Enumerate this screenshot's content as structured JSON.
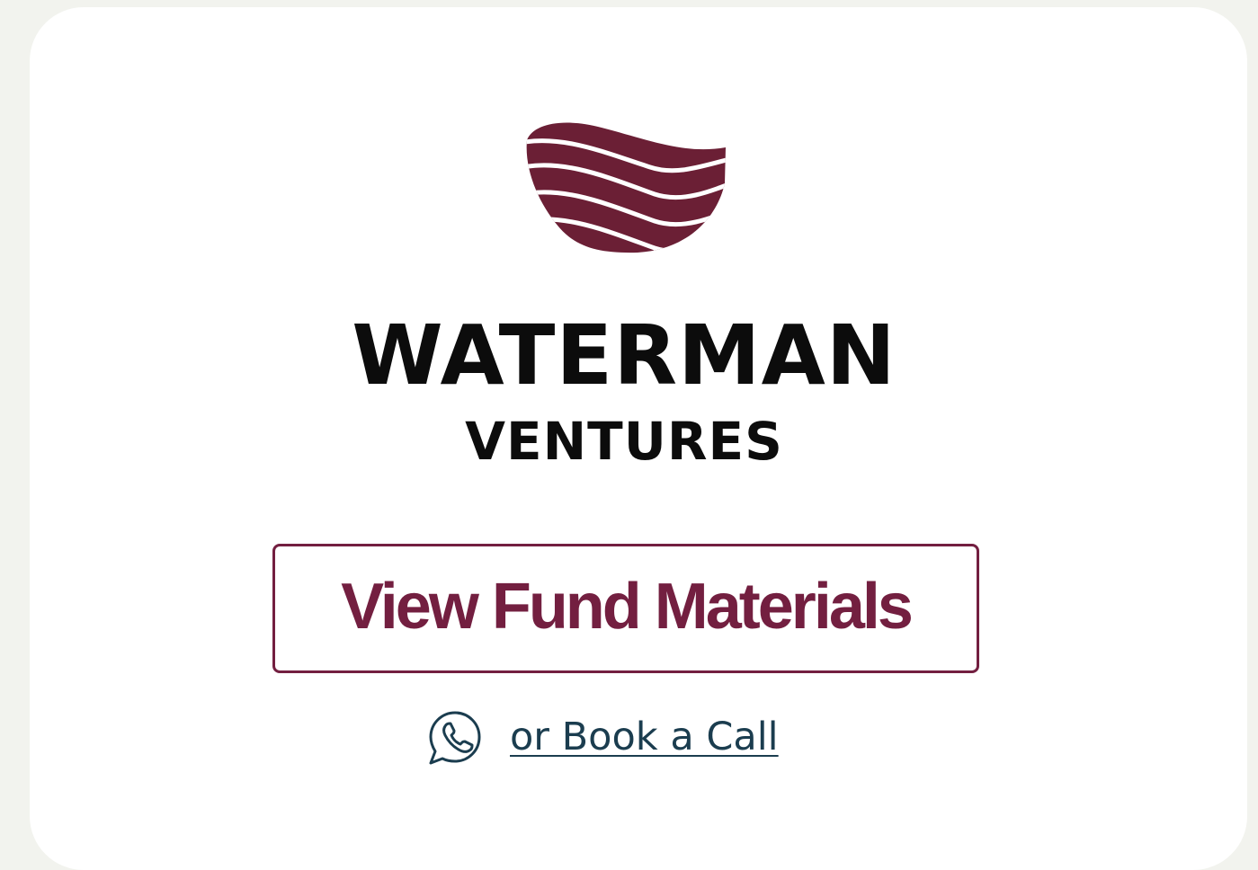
{
  "brand": {
    "name": "WATERMAN",
    "subname": "VENTURES",
    "logo_icon": "wave-heart-logo-icon",
    "brand_color": "#6b1f35"
  },
  "actions": {
    "view_fund_materials_label": "View Fund Materials",
    "book_call_label": "or Book a Call",
    "book_call_icon": "whatsapp-phone-icon"
  },
  "colors": {
    "page_background": "#f2f3ee",
    "card_background": "#ffffff",
    "button_accent": "#731f40",
    "link_color": "#1b3d4f",
    "wordmark_color": "#0c0c0c"
  }
}
